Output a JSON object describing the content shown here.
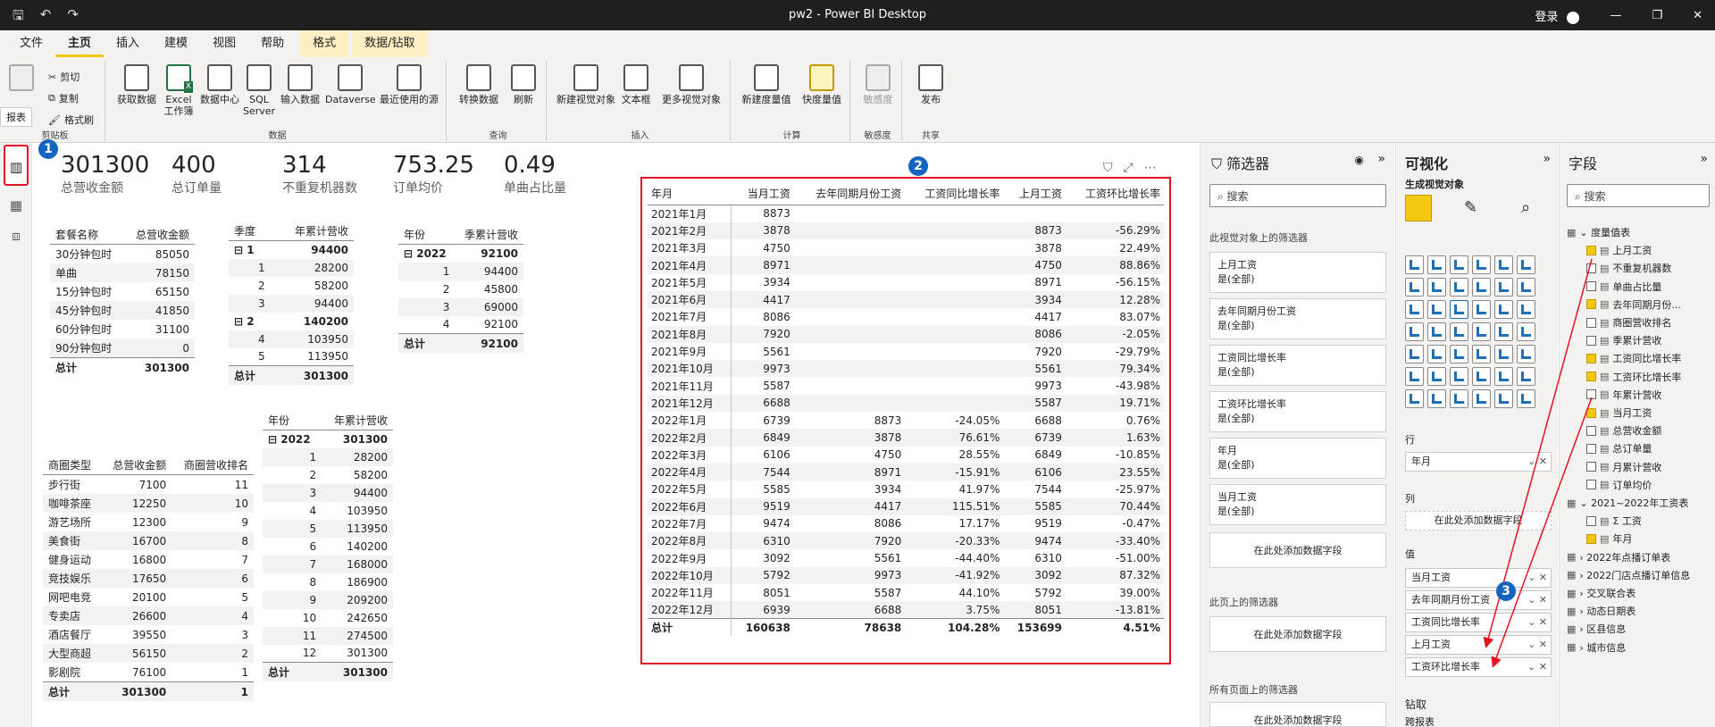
{
  "titlebar": {
    "title": "pw2 - Power BI Desktop",
    "signin": "登录"
  },
  "tabs": [
    "文件",
    "主页",
    "插入",
    "建模",
    "视图",
    "帮助",
    "格式",
    "数据/钻取"
  ],
  "ribbon": {
    "clipboard": {
      "cut": "剪切",
      "copy": "复制",
      "format_painter": "格式刷",
      "group": "剪贴板"
    },
    "data": {
      "group": "数据",
      "buttons": [
        "获取数据",
        "Excel 工作簿",
        "数据中心",
        "SQL Server",
        "输入数据",
        "Dataverse",
        "最近使用的源"
      ]
    },
    "query": {
      "group": "查询",
      "buttons": [
        "转换数据",
        "刷新"
      ]
    },
    "insert": {
      "group": "插入",
      "buttons": [
        "新建视觉对象",
        "文本框",
        "更多视觉对象"
      ]
    },
    "calc": {
      "group": "计算",
      "buttons": [
        "新建度量值",
        "快度量值"
      ]
    },
    "sens": {
      "group": "敏感度",
      "buttons": [
        "敏感度"
      ]
    },
    "share": {
      "group": "共享",
      "buttons": [
        "发布"
      ]
    }
  },
  "tooltip": "报表",
  "cards": [
    {
      "value": "301300",
      "label": "总营收金额"
    },
    {
      "value": "400",
      "label": "总订单量"
    },
    {
      "value": "314",
      "label": "不重复机器数"
    },
    {
      "value": "753.25",
      "label": "订单均价"
    },
    {
      "value": "0.49",
      "label": "单曲占比量"
    }
  ],
  "package_table": {
    "headers": [
      "套餐名称",
      "总营收金额"
    ],
    "rows": [
      [
        "30分钟包时",
        "85050"
      ],
      [
        "单曲",
        "78150"
      ],
      [
        "15分钟包时",
        "65150"
      ],
      [
        "45分钟包时",
        "41850"
      ],
      [
        "60分钟包时",
        "31100"
      ],
      [
        "90分钟包时",
        "0"
      ]
    ],
    "total": [
      "总计",
      "301300"
    ]
  },
  "quarter_table": {
    "headers": [
      "季度",
      "年累计营收"
    ],
    "rows": [
      [
        "⊟ 1",
        "94400",
        "g"
      ],
      [
        "1",
        "28200",
        ""
      ],
      [
        "2",
        "58200",
        ""
      ],
      [
        "3",
        "94400",
        ""
      ],
      [
        "⊟ 2",
        "140200",
        "g"
      ],
      [
        "4",
        "103950",
        ""
      ],
      [
        "5",
        "113950",
        ""
      ]
    ],
    "total": [
      "总计",
      "301300"
    ]
  },
  "year_quarter_table": {
    "headers": [
      "年份",
      "季累计营收"
    ],
    "rows": [
      [
        "⊟ 2022",
        "92100",
        "g"
      ],
      [
        "1",
        "94400",
        ""
      ],
      [
        "2",
        "45800",
        ""
      ],
      [
        "3",
        "69000",
        ""
      ],
      [
        "4",
        "92100",
        ""
      ]
    ],
    "total": [
      "总计",
      "92100"
    ]
  },
  "year_month_table": {
    "headers": [
      "年份",
      "年累计营收"
    ],
    "rows": [
      [
        "⊟ 2022",
        "301300",
        "g"
      ],
      [
        "1",
        "28200",
        ""
      ],
      [
        "2",
        "58200",
        ""
      ],
      [
        "3",
        "94400",
        ""
      ],
      [
        "4",
        "103950",
        ""
      ],
      [
        "5",
        "113950",
        ""
      ],
      [
        "6",
        "140200",
        ""
      ],
      [
        "7",
        "168000",
        ""
      ],
      [
        "8",
        "186900",
        ""
      ],
      [
        "9",
        "209200",
        ""
      ],
      [
        "10",
        "242650",
        ""
      ],
      [
        "11",
        "274500",
        ""
      ],
      [
        "12",
        "301300",
        ""
      ]
    ],
    "total": [
      "总计",
      "301300"
    ]
  },
  "district_table": {
    "headers": [
      "商圈类型",
      "总营收金额",
      "商圈营收排名"
    ],
    "rows": [
      [
        "步行街",
        "7100",
        "11"
      ],
      [
        "咖啡茶座",
        "12250",
        "10"
      ],
      [
        "游艺场所",
        "12300",
        "9"
      ],
      [
        "美食街",
        "16700",
        "8"
      ],
      [
        "健身运动",
        "16800",
        "7"
      ],
      [
        "竞技娱乐",
        "17650",
        "6"
      ],
      [
        "网吧电竞",
        "20100",
        "5"
      ],
      [
        "专卖店",
        "26600",
        "4"
      ],
      [
        "酒店餐厅",
        "39550",
        "3"
      ],
      [
        "大型商超",
        "56150",
        "2"
      ],
      [
        "影剧院",
        "76100",
        "1"
      ]
    ],
    "total": [
      "总计",
      "301300",
      "1"
    ]
  },
  "salary_table": {
    "headers": [
      "年月",
      "当月工资",
      "去年同期月份工资",
      "工资同比增长率",
      "上月工资",
      "工资环比增长率"
    ],
    "rows": [
      [
        "2021年1月",
        "8873",
        "",
        "",
        "",
        ""
      ],
      [
        "2021年2月",
        "3878",
        "",
        "",
        "8873",
        "-56.29%"
      ],
      [
        "2021年3月",
        "4750",
        "",
        "",
        "3878",
        "22.49%"
      ],
      [
        "2021年4月",
        "8971",
        "",
        "",
        "4750",
        "88.86%"
      ],
      [
        "2021年5月",
        "3934",
        "",
        "",
        "8971",
        "-56.15%"
      ],
      [
        "2021年6月",
        "4417",
        "",
        "",
        "3934",
        "12.28%"
      ],
      [
        "2021年7月",
        "8086",
        "",
        "",
        "4417",
        "83.07%"
      ],
      [
        "2021年8月",
        "7920",
        "",
        "",
        "8086",
        "-2.05%"
      ],
      [
        "2021年9月",
        "5561",
        "",
        "",
        "7920",
        "-29.79%"
      ],
      [
        "2021年10月",
        "9973",
        "",
        "",
        "5561",
        "79.34%"
      ],
      [
        "2021年11月",
        "5587",
        "",
        "",
        "9973",
        "-43.98%"
      ],
      [
        "2021年12月",
        "6688",
        "",
        "",
        "5587",
        "19.71%"
      ],
      [
        "2022年1月",
        "6739",
        "8873",
        "-24.05%",
        "6688",
        "0.76%"
      ],
      [
        "2022年2月",
        "6849",
        "3878",
        "76.61%",
        "6739",
        "1.63%"
      ],
      [
        "2022年3月",
        "6106",
        "4750",
        "28.55%",
        "6849",
        "-10.85%"
      ],
      [
        "2022年4月",
        "7544",
        "8971",
        "-15.91%",
        "6106",
        "23.55%"
      ],
      [
        "2022年5月",
        "5585",
        "3934",
        "41.97%",
        "7544",
        "-25.97%"
      ],
      [
        "2022年6月",
        "9519",
        "4417",
        "115.51%",
        "5585",
        "70.44%"
      ],
      [
        "2022年7月",
        "9474",
        "8086",
        "17.17%",
        "9519",
        "-0.47%"
      ],
      [
        "2022年8月",
        "6310",
        "7920",
        "-20.33%",
        "9474",
        "-33.40%"
      ],
      [
        "2022年9月",
        "3092",
        "5561",
        "-44.40%",
        "6310",
        "-51.00%"
      ],
      [
        "2022年10月",
        "5792",
        "9973",
        "-41.92%",
        "3092",
        "87.32%"
      ],
      [
        "2022年11月",
        "8051",
        "5587",
        "44.10%",
        "5792",
        "39.00%"
      ],
      [
        "2022年12月",
        "6939",
        "6688",
        "3.75%",
        "8051",
        "-13.81%"
      ]
    ],
    "total": [
      "总计",
      "160638",
      "78638",
      "104.28%",
      "153699",
      "4.51%"
    ]
  },
  "filters": {
    "title": "筛选器",
    "search": "搜索",
    "visual_section": "此视觉对象上的筛选器",
    "page_section": "此页上的筛选器",
    "all_section": "所有页面上的筛选器",
    "cards": [
      [
        "上月工资",
        "是(全部)"
      ],
      [
        "去年同期月份工资",
        "是(全部)"
      ],
      [
        "工资同比增长率",
        "是(全部)"
      ],
      [
        "工资环比增长率",
        "是(全部)"
      ],
      [
        "年月",
        "是(全部)"
      ],
      [
        "当月工资",
        "是(全部)"
      ]
    ],
    "add": "在此处添加数据字段"
  },
  "viz": {
    "title": "可视化",
    "subtitle": "生成视觉对象",
    "rows_label": "行",
    "rows_field": "年月",
    "cols_label": "列",
    "cols_add": "在此处添加数据字段",
    "values_label": "值",
    "values": [
      "当月工资",
      "去年同期月份工资",
      "工资同比增长率",
      "上月工资",
      "工资环比增长率"
    ],
    "drill_label": "钻取",
    "drill_sub": "跨报表"
  },
  "fields": {
    "title": "字段",
    "search": "搜索",
    "items": [
      [
        "⌄ 度量值表",
        "table",
        false
      ],
      [
        "上月工资",
        "m",
        true
      ],
      [
        "不重复机器数",
        "m",
        false
      ],
      [
        "单曲占比量",
        "m",
        false
      ],
      [
        "去年同期月份...",
        "m",
        true
      ],
      [
        "商圈营收排名",
        "m",
        false
      ],
      [
        "季累计营收",
        "m",
        false
      ],
      [
        "工资同比增长率",
        "m",
        true
      ],
      [
        "工资环比增长率",
        "m",
        true
      ],
      [
        "年累计营收",
        "m",
        false
      ],
      [
        "当月工资",
        "m",
        true
      ],
      [
        "总营收金额",
        "m",
        false
      ],
      [
        "总订单量",
        "m",
        false
      ],
      [
        "月累计营收",
        "m",
        false
      ],
      [
        "订单均价",
        "m",
        false
      ],
      [
        "⌄ 2021~2022年工资表",
        "table",
        false
      ],
      [
        "Σ 工资",
        "m",
        false
      ],
      [
        "年月",
        "m",
        true
      ],
      [
        "› 2022年点播订单表",
        "table",
        false
      ],
      [
        "› 2022门店点播订单信息",
        "table",
        false
      ],
      [
        "› 交叉联合表",
        "table",
        false
      ],
      [
        "› 动态日期表",
        "table",
        false
      ],
      [
        "› 区县信息",
        "table",
        false
      ],
      [
        "› 城市信息",
        "table",
        false
      ]
    ]
  },
  "badges": [
    "1",
    "2",
    "3"
  ]
}
